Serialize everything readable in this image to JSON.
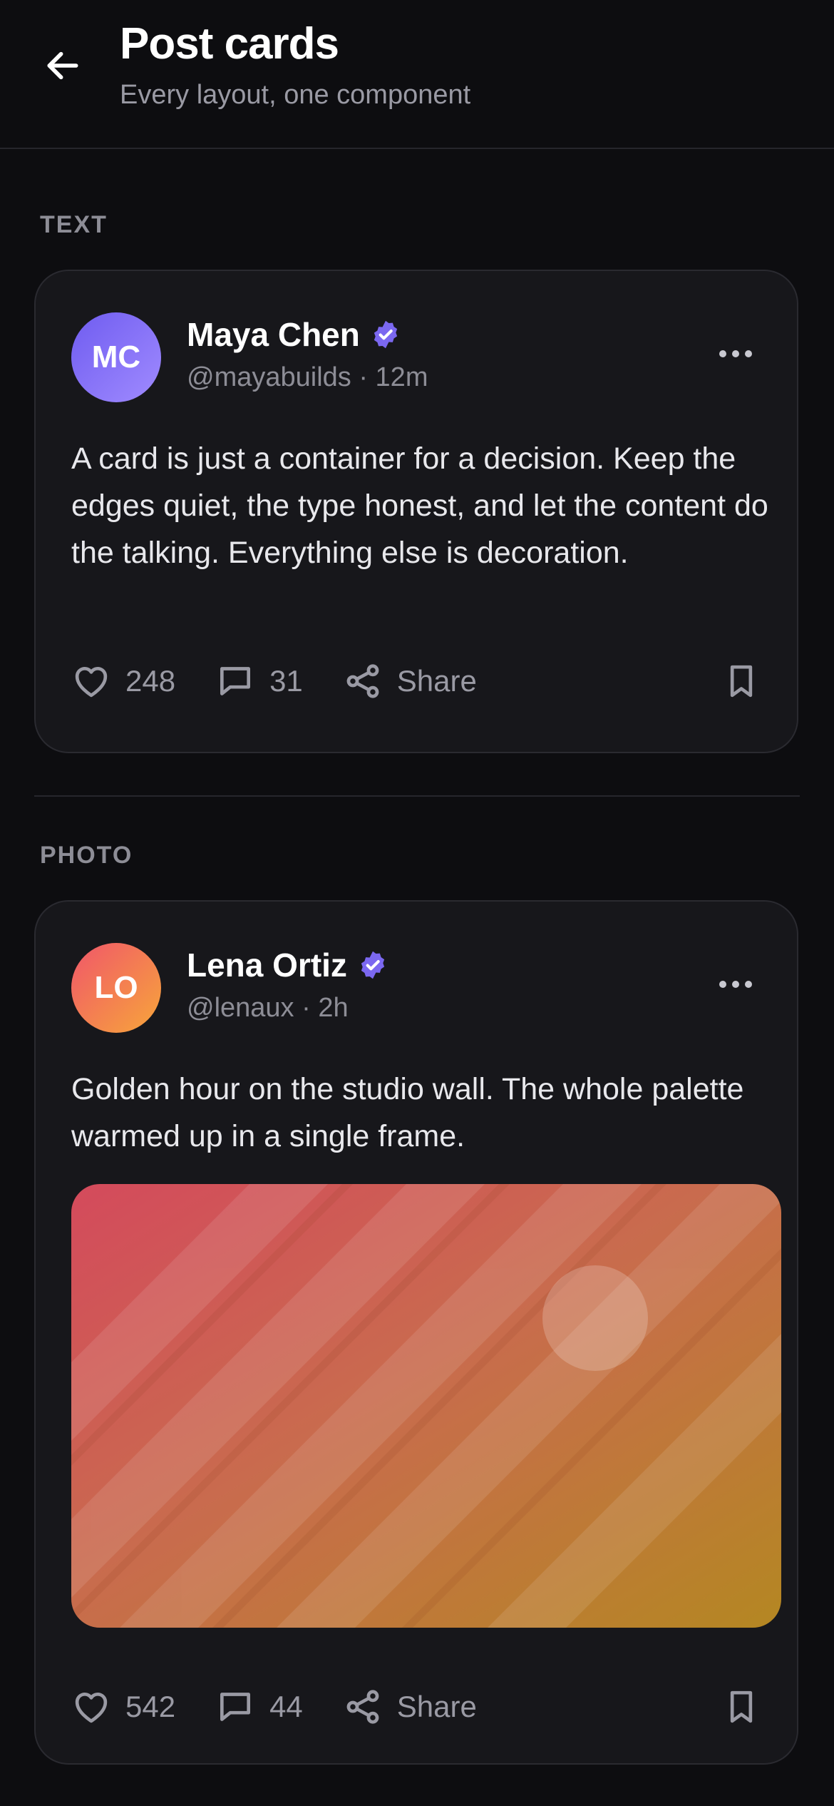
{
  "header": {
    "title": "Post cards",
    "subtitle": "Every layout, one component"
  },
  "sections": [
    {
      "label": "TEXT",
      "post": {
        "avatar_initials": "MC",
        "avatar_color": "#7b68f0",
        "name": "Maya Chen",
        "verified": true,
        "meta": "@mayabuilds · 12m",
        "text": "A card is just a container for a decision. Keep the edges quiet, the type honest, and let the content do the talking. Everything else is decoration.",
        "likes": "248",
        "comments": "31",
        "share_label": "Share"
      }
    },
    {
      "label": "PHOTO",
      "post": {
        "avatar_initials": "LO",
        "avatar_color": "#f4774f",
        "name": "Lena Ortiz",
        "verified": true,
        "meta": "@lenaux · 2h",
        "text": "Golden hour on the studio wall. The whole palette warmed up in a single frame.",
        "likes": "542",
        "comments": "44",
        "share_label": "Share"
      }
    }
  ],
  "colors": {
    "background": "#0d0d10",
    "card": "#17171b",
    "verified": "#7b68f0",
    "muted": "#9a9aa4"
  }
}
